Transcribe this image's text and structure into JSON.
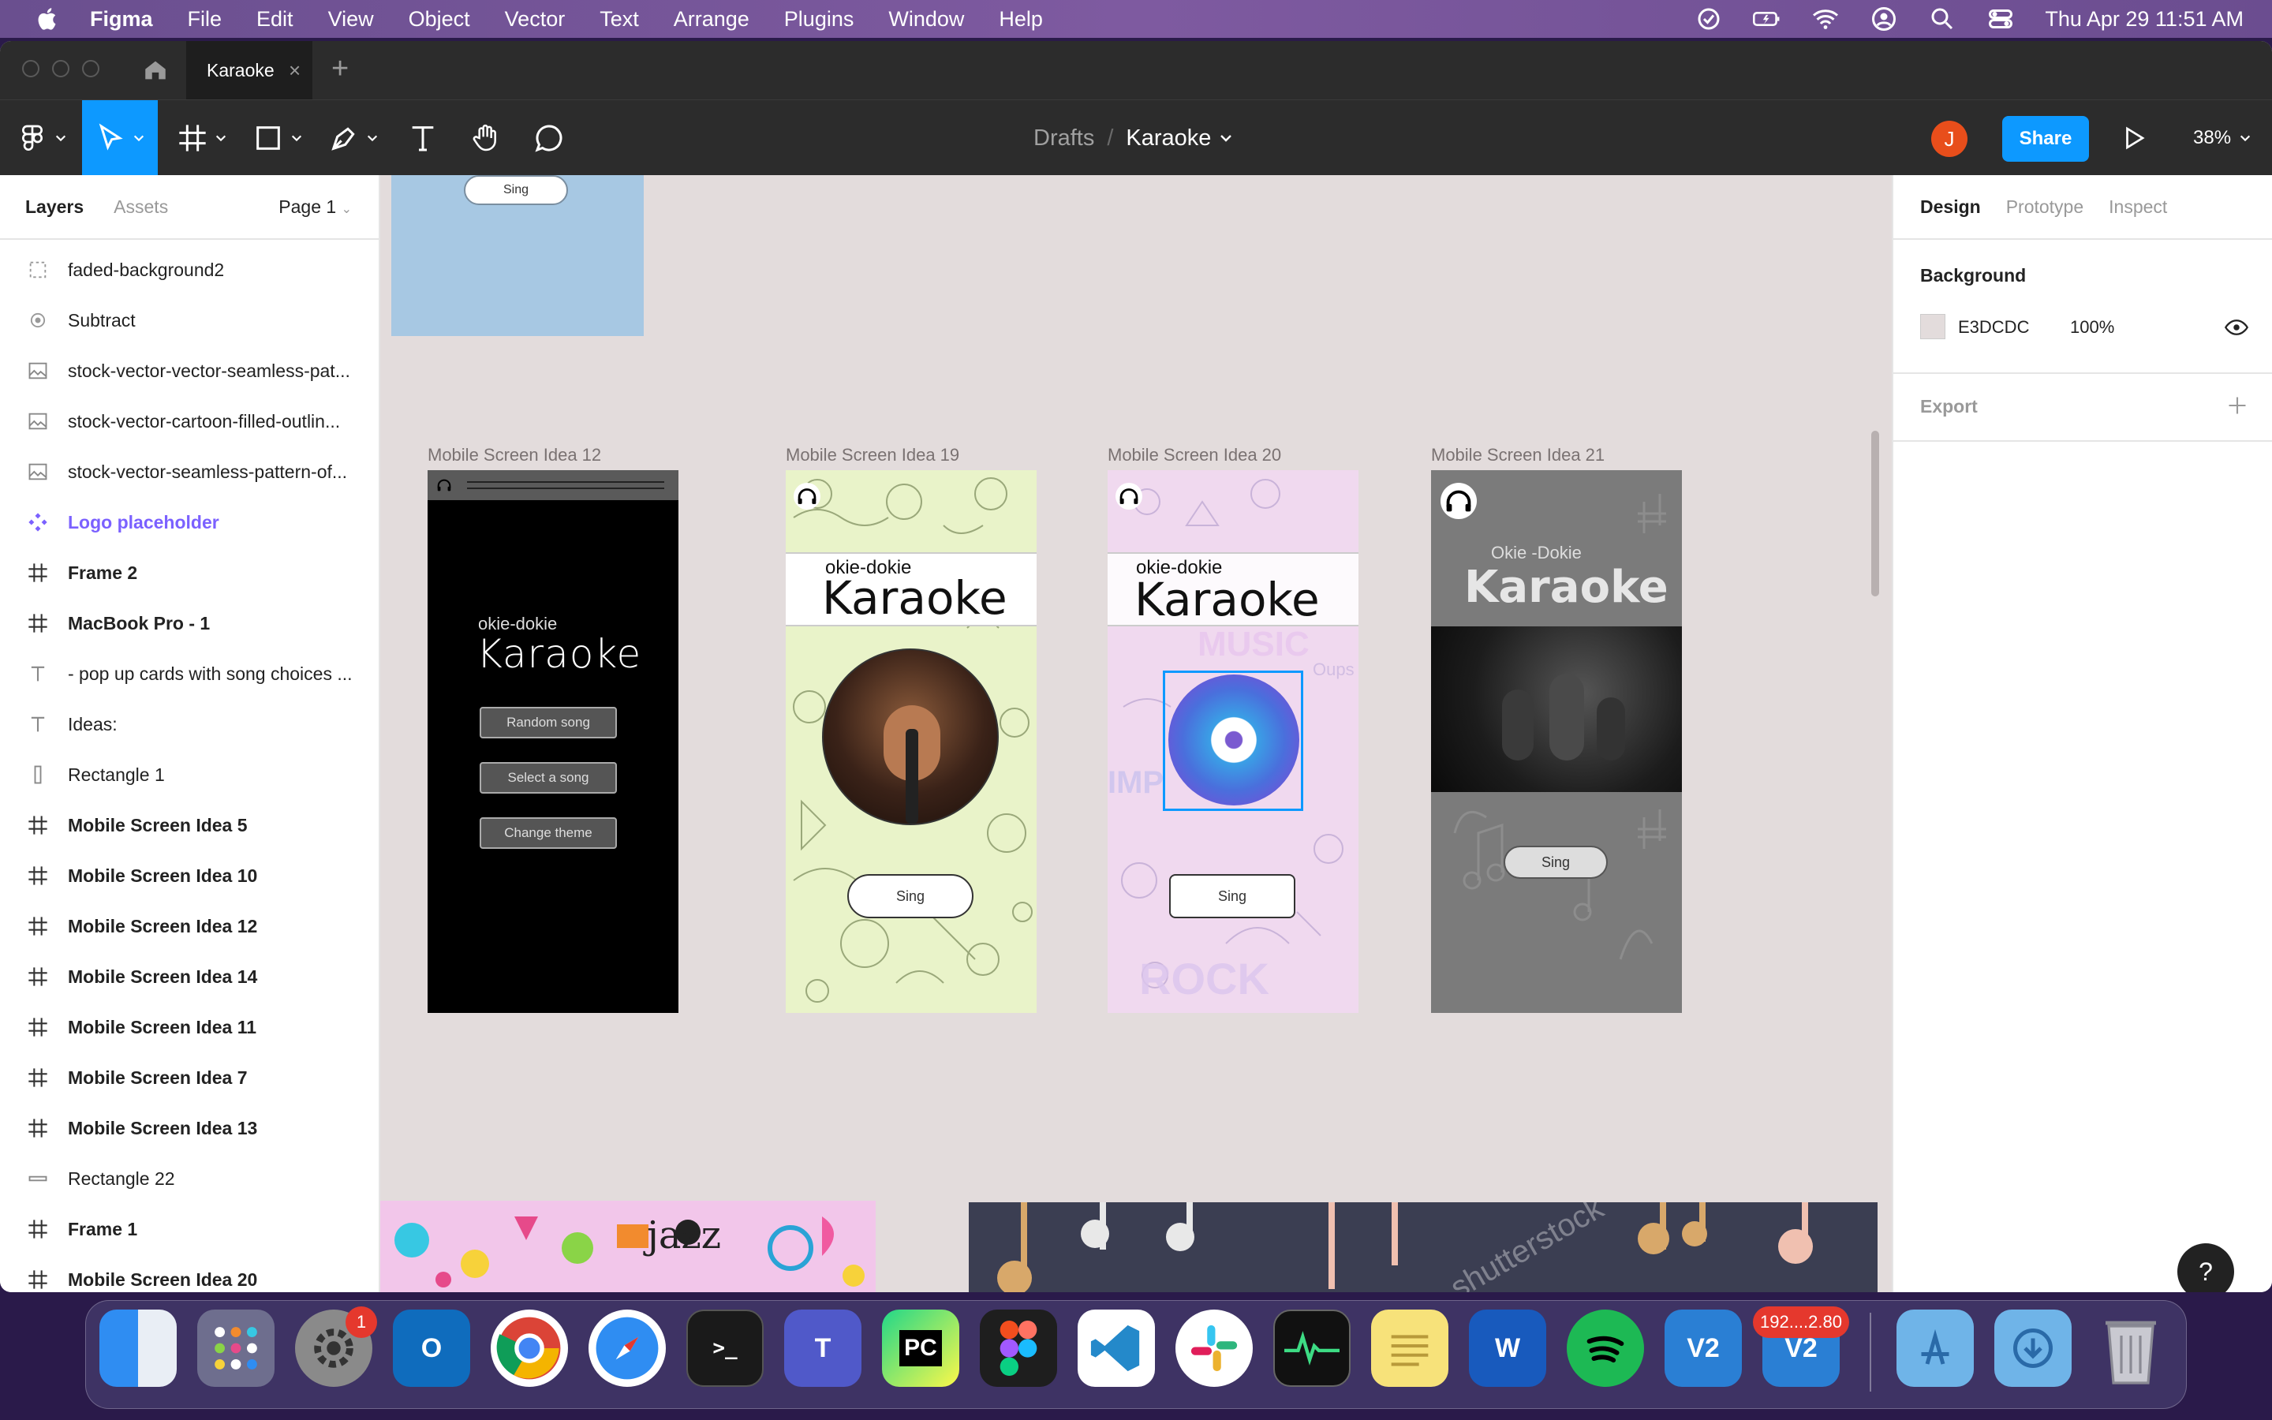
{
  "menubar": {
    "app": "Figma",
    "items": [
      "File",
      "Edit",
      "View",
      "Object",
      "Vector",
      "Text",
      "Arrange",
      "Plugins",
      "Window",
      "Help"
    ],
    "clock": "Thu Apr 29  11:51 AM"
  },
  "titlebar": {
    "tab": "Karaoke"
  },
  "toolbar": {
    "breadcrumb_drafts": "Drafts",
    "breadcrumb_sep": "/",
    "file_name": "Karaoke",
    "avatar": "J",
    "share": "Share",
    "zoom": "38%"
  },
  "left_panel": {
    "tab_layers": "Layers",
    "tab_assets": "Assets",
    "page": "Page 1",
    "layers": [
      {
        "name": "faded-background2",
        "icon": "dashed-frame-icon",
        "kind": "plain"
      },
      {
        "name": "Subtract",
        "icon": "boolean-icon",
        "kind": "plain"
      },
      {
        "name": "stock-vector-vector-seamless-pat...",
        "icon": "image-icon",
        "kind": "plain"
      },
      {
        "name": "stock-vector-cartoon-filled-outlin...",
        "icon": "image-icon",
        "kind": "plain"
      },
      {
        "name": "stock-vector-seamless-pattern-of...",
        "icon": "image-icon",
        "kind": "plain"
      },
      {
        "name": "Logo placeholder",
        "icon": "component-icon",
        "kind": "component"
      },
      {
        "name": "Frame 2",
        "icon": "frame-icon",
        "kind": "frame"
      },
      {
        "name": "MacBook Pro - 1",
        "icon": "frame-icon",
        "kind": "frame"
      },
      {
        "name": "- pop up cards with song choices ...",
        "icon": "text-icon",
        "kind": "plain"
      },
      {
        "name": "Ideas:",
        "icon": "text-icon",
        "kind": "plain"
      },
      {
        "name": "Rectangle 1",
        "icon": "rectangle-vertical-icon",
        "kind": "plain"
      },
      {
        "name": "Mobile Screen Idea 5",
        "icon": "frame-icon",
        "kind": "frame"
      },
      {
        "name": "Mobile Screen Idea 10",
        "icon": "frame-icon",
        "kind": "frame"
      },
      {
        "name": "Mobile Screen Idea 12",
        "icon": "frame-icon",
        "kind": "frame"
      },
      {
        "name": "Mobile Screen Idea 14",
        "icon": "frame-icon",
        "kind": "frame"
      },
      {
        "name": "Mobile Screen Idea 11",
        "icon": "frame-icon",
        "kind": "frame"
      },
      {
        "name": "Mobile Screen Idea 7",
        "icon": "frame-icon",
        "kind": "frame"
      },
      {
        "name": "Mobile Screen Idea 13",
        "icon": "frame-icon",
        "kind": "frame"
      },
      {
        "name": "Rectangle 22",
        "icon": "line-icon",
        "kind": "plain"
      },
      {
        "name": "Frame 1",
        "icon": "frame-icon",
        "kind": "frame"
      },
      {
        "name": "Mobile Screen Idea 20",
        "icon": "frame-icon",
        "kind": "frame"
      }
    ]
  },
  "canvas": {
    "top_frame_button": "Sing",
    "frames": [
      {
        "label": "Mobile Screen Idea 12",
        "subtitle": "okie-dokie",
        "title": "Karaoke",
        "buttons": [
          "Random song",
          "Select a song",
          "Change theme"
        ]
      },
      {
        "label": "Mobile Screen Idea 19",
        "subtitle": "okie-dokie",
        "title": "Karaoke",
        "button": "Sing"
      },
      {
        "label": "Mobile Screen Idea 20",
        "subtitle": "okie-dokie",
        "title": "Karaoke",
        "bg_words": [
          "MUSIC",
          "ROCK",
          "Oups",
          "IMP"
        ],
        "button": "Sing"
      },
      {
        "label": "Mobile Screen Idea 21",
        "subtitle": "Okie -Dokie",
        "title": "Karaoke",
        "button": "Sing"
      }
    ],
    "bottom_left_word": "jazz",
    "bottom_right_watermark": "shutterstock"
  },
  "right_panel": {
    "tabs": [
      "Design",
      "Prototype",
      "Inspect"
    ],
    "background_title": "Background",
    "background_hex": "E3DCDC",
    "background_opacity": "100%",
    "export_title": "Export",
    "help": "?"
  },
  "dock": {
    "settings_badge": "1",
    "vnc_badge": "192....2.80"
  },
  "colors": {
    "canvas": "#e3dcdc",
    "accent": "#0d99ff",
    "component": "#7b61ff",
    "avatar": "#e84e1b"
  }
}
